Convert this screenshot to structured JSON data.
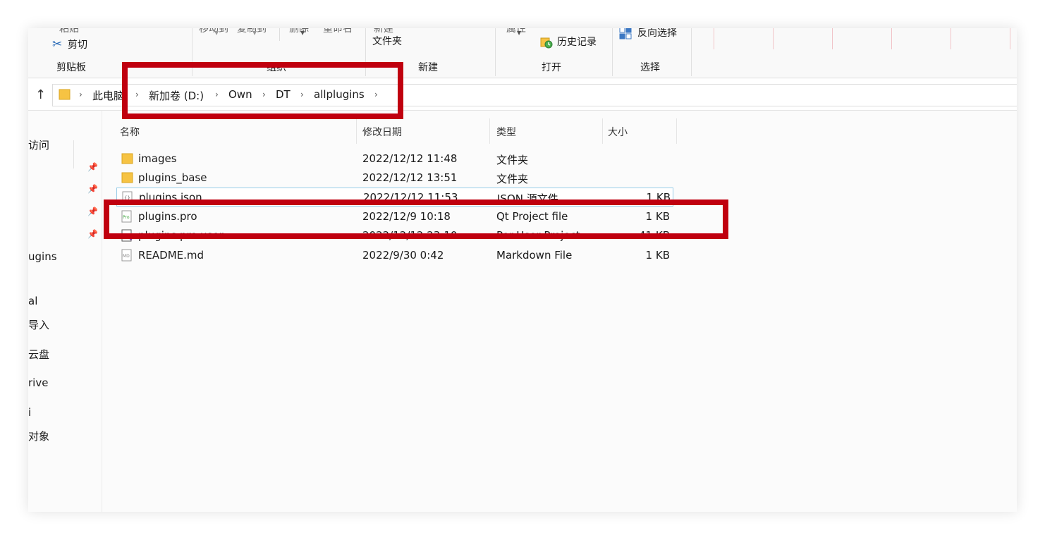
{
  "ribbon": {
    "clipboard": {
      "cut_label": "剪切",
      "group_label": "剪贴板",
      "partial_top": "粘贴"
    },
    "organize": {
      "group_label": "组织",
      "partial_top_1": "移动到",
      "partial_top_2": "复制到",
      "partial_top_3": "删除",
      "partial_top_4": "重命名"
    },
    "new": {
      "group_label": "新建",
      "partial_top": "新建",
      "folder_label": "文件夹"
    },
    "open": {
      "group_label": "打开",
      "partial_top": "属性",
      "history_label": "历史记录"
    },
    "select": {
      "group_label": "选择",
      "invert_label": "反向选择"
    }
  },
  "address_bar": {
    "crumbs": [
      "此电脑",
      "新加卷 (D:)",
      "Own",
      "DT",
      "allplugins"
    ]
  },
  "nav_pane": {
    "items": [
      "访问",
      "ugins",
      "al",
      "导入",
      "云盘",
      "rive",
      "i",
      "对象"
    ]
  },
  "columns": {
    "name": "名称",
    "modified": "修改日期",
    "type": "类型",
    "size": "大小"
  },
  "files": [
    {
      "icon": "folder-icon",
      "name": "images",
      "modified": "2022/12/12 11:48",
      "type": "文件夹",
      "size": ""
    },
    {
      "icon": "folder-icon",
      "name": "plugins_base",
      "modified": "2022/12/12 13:51",
      "type": "文件夹",
      "size": ""
    },
    {
      "icon": "json-file-icon",
      "name": "plugins.json",
      "modified": "2022/12/12 11:53",
      "type": "JSON 源文件",
      "size": "1 KB"
    },
    {
      "icon": "qt-pro-file-icon",
      "name": "plugins.pro",
      "modified": "2022/12/9 10:18",
      "type": "Qt Project file",
      "size": "1 KB"
    },
    {
      "icon": "pro-user-file-icon",
      "name": "plugins.pro.user",
      "modified": "2022/12/12 23:10",
      "type": "Per-User Project...",
      "size": "41 KB"
    },
    {
      "icon": "md-file-icon",
      "name": "README.md",
      "modified": "2022/9/30 0:42",
      "type": "Markdown File",
      "size": "1 KB"
    }
  ],
  "colors": {
    "annotation_red": "#c0000f",
    "folder_yellow": "#f6c343",
    "hover_border": "#99cde8"
  }
}
